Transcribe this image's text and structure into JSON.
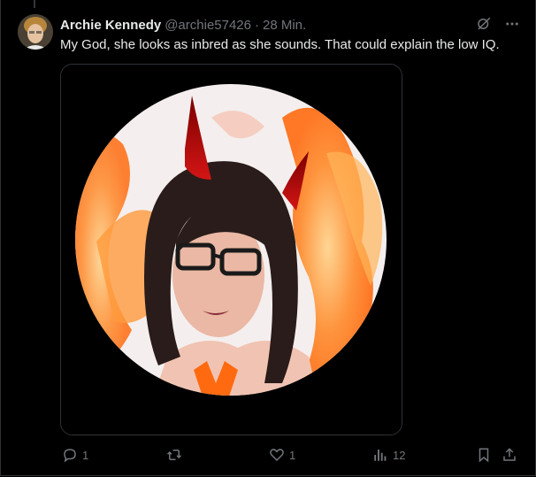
{
  "tweet": {
    "author_name": "Archie Kennedy",
    "author_handle": "@archie57426",
    "separator": "·",
    "time_ago": "28 Min.",
    "text": "My God, she looks as inbred as she sounds. That could explain the low IQ."
  },
  "actions": {
    "replies": "1",
    "retweets": "",
    "likes": "1",
    "views": "12"
  },
  "icons": {
    "grok": "grok-icon",
    "more": "more-icon",
    "reply": "reply-icon",
    "retweet": "retweet-icon",
    "like": "heart-icon",
    "views": "views-icon",
    "bookmark": "bookmark-icon",
    "share": "share-icon"
  },
  "colors": {
    "background": "#000000",
    "text": "#e7e9ea",
    "muted": "#71767b",
    "border": "#2f3336"
  }
}
